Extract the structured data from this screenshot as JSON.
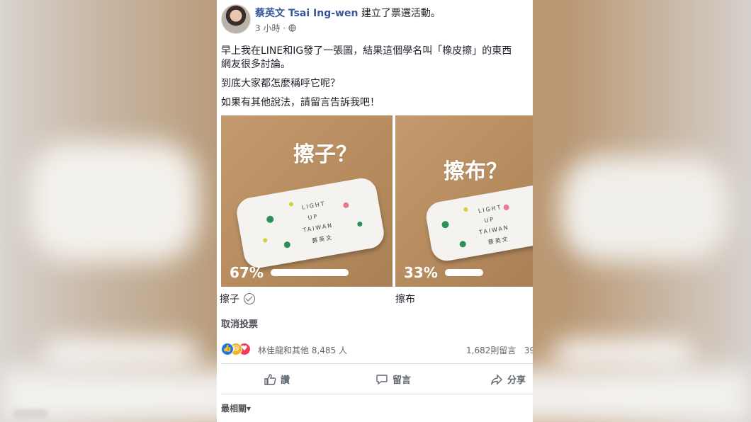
{
  "post": {
    "author": "蔡英文 Tsai Ing-wen",
    "action_text": " 建立了票選活動。",
    "timestamp": "3 小時",
    "separator": " · ",
    "privacy_icon": "globe-icon",
    "body_line1": "早上我在LINE和IG發了一張圖，結果這個學名叫「橡皮擦」的東西",
    "body_line2": "網友很多討論。",
    "body_line3": "到底大家都怎麼稱呼它呢？",
    "body_line4": "如果有其他說法，請留言告訴我吧！"
  },
  "poll": {
    "options": [
      {
        "image_text": "擦子？",
        "percent_label": "67%",
        "percent": 67,
        "choice": "擦子",
        "selected": true,
        "tube_lines": [
          "LIGHT",
          "UP",
          "TAIWAN",
          "蔡英文"
        ]
      },
      {
        "image_text": "擦布？",
        "percent_label": "33%",
        "percent": 33,
        "choice": "擦布",
        "selected": false,
        "tube_lines": [
          "LIGHT",
          "UP",
          "TAIWAN",
          "蔡英文"
        ]
      }
    ],
    "cancel_vote": "取消投票"
  },
  "reactions": {
    "icons": [
      "like-icon",
      "haha-icon",
      "love-icon"
    ],
    "summary": "林佳龍和其他 8,485 人",
    "comments": "1,682則留言",
    "shares_partial": "39"
  },
  "actions": {
    "like": "讚",
    "comment": "留言",
    "share": "分享"
  },
  "comment_sort": {
    "label": "最相關",
    "arrow": "▾"
  },
  "colors": {
    "link_blue": "#365899",
    "text": "#1d2129",
    "muted": "#616770",
    "like_blue": "#1877f2",
    "haha_yellow": "#f7b125",
    "love_red": "#f33e58"
  }
}
